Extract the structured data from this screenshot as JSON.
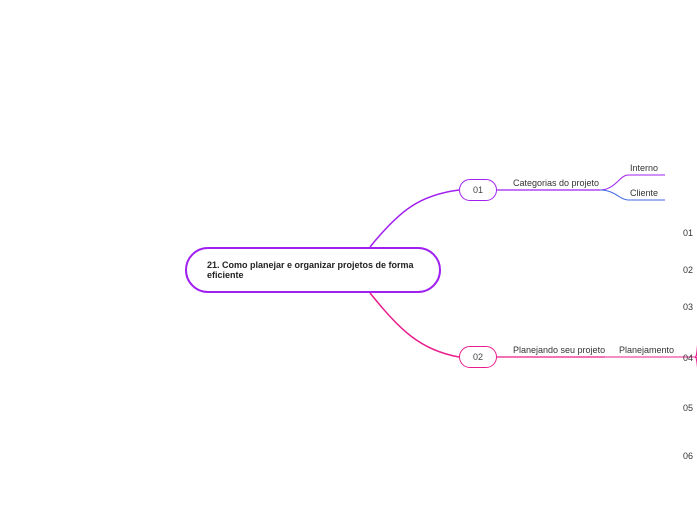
{
  "central": {
    "title": "21. Como planejar e organizar projetos de forma eficiente"
  },
  "branch1": {
    "num": "01",
    "label": "Categorias do projeto",
    "children": [
      {
        "label": "Interno"
      },
      {
        "label": "Cliente"
      }
    ]
  },
  "branch2": {
    "num": "02",
    "label": "Planejando seu projeto",
    "sub": {
      "label": "Planejamento",
      "items": [
        "01",
        "02",
        "03",
        "04",
        "05",
        "06"
      ]
    }
  },
  "colors": {
    "purple": "#a020f0",
    "pink": "#e91e8c",
    "blue": "#4169e1"
  }
}
